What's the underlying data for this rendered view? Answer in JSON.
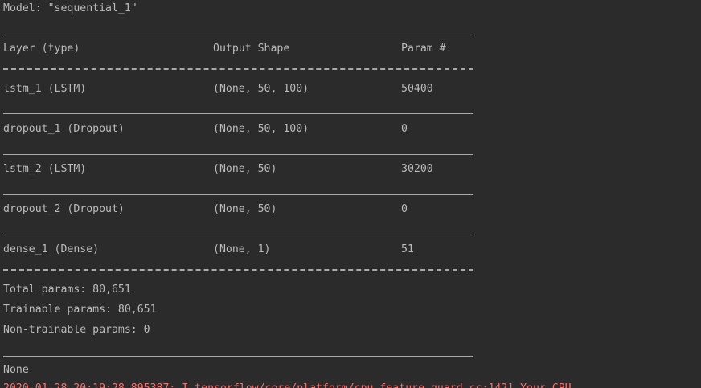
{
  "model_line": "Model: \"sequential_1\"",
  "header": {
    "layer": "Layer (type)",
    "output_shape": "Output Shape",
    "param": "Param #"
  },
  "layers": [
    {
      "name": "lstm_1 (LSTM)",
      "shape": "(None, 50, 100)",
      "params": "50400"
    },
    {
      "name": "dropout_1 (Dropout)",
      "shape": "(None, 50, 100)",
      "params": "0"
    },
    {
      "name": "lstm_2 (LSTM)",
      "shape": "(None, 50)",
      "params": "30200"
    },
    {
      "name": "dropout_2 (Dropout)",
      "shape": "(None, 50)",
      "params": "0"
    },
    {
      "name": "dense_1 (Dense)",
      "shape": "(None, 1)",
      "params": "51"
    }
  ],
  "summary": {
    "total": "Total params: 80,651",
    "trainable": "Trainable params: 80,651",
    "non_trainable": "Non-trainable params: 0"
  },
  "return_value": "None",
  "stderr_line": "2020-01-28 20:19:28.895387: I tensorflow/core/platform/cpu_feature_guard.cc:142] Your CPU"
}
